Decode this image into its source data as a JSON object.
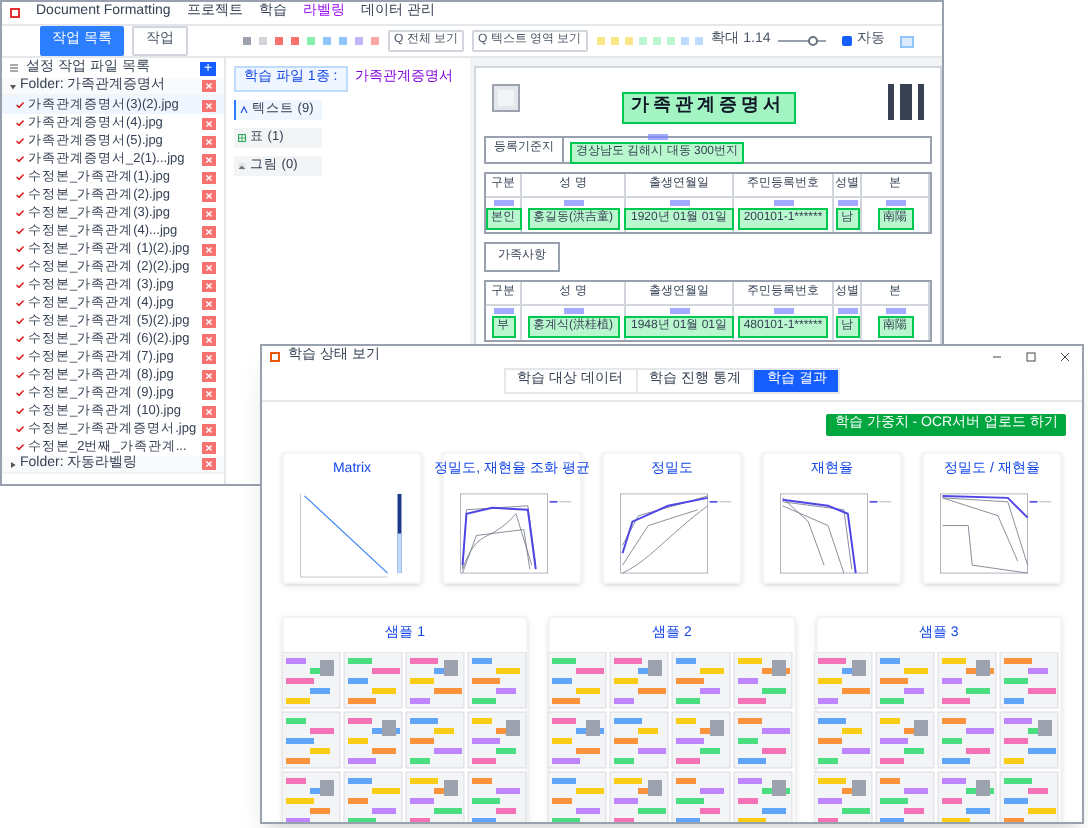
{
  "main_window": {
    "title": "Document Formatting",
    "menu": [
      "프로젝트",
      "학습",
      "라벨링",
      "데이터 관리"
    ],
    "toolbar": {
      "tabs": [
        {
          "label": "작업 목록",
          "selected": true
        },
        {
          "label": "작업",
          "selected": false
        }
      ],
      "buttons": [
        "Q 전체 보기",
        "Q 텍스트 영역 보기"
      ],
      "zoom_label": "확대 1.14",
      "zoom": {
        "level": 0.7
      },
      "auto": {
        "label": "자동",
        "checked": true
      }
    },
    "file_list": {
      "header": "설정 작업 파일 목록",
      "add_button": "+",
      "folders": [
        {
          "label": "Folder: 가족관계증명서",
          "expanded": true,
          "files": [
            {
              "name": "가족관계증명서(3)(2).jpg",
              "checked": true,
              "selected": true
            },
            {
              "name": "가족관계증명서(4).jpg",
              "checked": true,
              "selected": false
            },
            {
              "name": "가족관계증명서(5).jpg",
              "checked": true,
              "selected": false
            },
            {
              "name": "가족관계증명서_2(1)...jpg",
              "checked": true,
              "selected": false
            },
            {
              "name": "수정본_가족관계(1).jpg",
              "checked": true,
              "selected": false
            },
            {
              "name": "수정본_가족관계(2).jpg",
              "checked": true,
              "selected": false
            },
            {
              "name": "수정본_가족관계(3).jpg",
              "checked": true,
              "selected": false
            },
            {
              "name": "수정본_가족관계(4)...jpg",
              "checked": true,
              "selected": false
            },
            {
              "name": "수정본_가족관계 (1)(2).jpg",
              "checked": true,
              "selected": false
            },
            {
              "name": "수정본_가족관계 (2)(2).jpg",
              "checked": true,
              "selected": false
            },
            {
              "name": "수정본_가족관계 (3).jpg",
              "checked": true,
              "selected": false
            },
            {
              "name": "수정본_가족관계 (4).jpg",
              "checked": true,
              "selected": false
            },
            {
              "name": "수정본_가족관계 (5)(2).jpg",
              "checked": true,
              "selected": false
            },
            {
              "name": "수정본_가족관계 (6)(2).jpg",
              "checked": true,
              "selected": false
            },
            {
              "name": "수정본_가족관계 (7).jpg",
              "checked": true,
              "selected": false
            },
            {
              "name": "수정본_가족관계 (8).jpg",
              "checked": true,
              "selected": false
            },
            {
              "name": "수정본_가족관계 (9).jpg",
              "checked": true,
              "selected": false
            },
            {
              "name": "수정본_가족관계 (10).jpg",
              "checked": true,
              "selected": false
            },
            {
              "name": "수정본_가족관계증명서.jpg",
              "checked": true,
              "selected": false
            },
            {
              "name": "수정본_2번째_가족관계...",
              "checked": true,
              "selected": false
            }
          ]
        },
        {
          "label": "Folder: 자동라벨링",
          "expanded": false
        }
      ]
    },
    "panel": {
      "title": "학습 파일 1종 :",
      "doc_name": "가족관계증명서",
      "items": [
        {
          "kind": "text",
          "label": "텍스트 (9)",
          "selected": true
        },
        {
          "kind": "table",
          "label": "표 (1)",
          "selected": false
        },
        {
          "kind": "image",
          "label": "그림 (0)",
          "selected": false
        }
      ]
    },
    "document": {
      "title": "가족관계증명서",
      "origin_label": "등록기준지",
      "origin_value": "경상남도 김해시 대동 300번지",
      "columns": [
        "구분",
        "성 명",
        "출생연월일",
        "주민등록번호",
        "성별",
        "본"
      ],
      "self_row": [
        "본인",
        "홍길동(洪吉童)",
        "1920년 01월 01일",
        "200101-1******",
        "남",
        "南陽"
      ],
      "family_label": "가족사항",
      "family_columns": [
        "구분",
        "성 명",
        "출생연월일",
        "주민등록번호",
        "성별",
        "본"
      ],
      "family_rows": [
        [
          "부",
          "홍계식(洪桂植)",
          "1948년 01월 01일",
          "480101-1******",
          "남",
          "南陽"
        ]
      ]
    }
  },
  "dialog": {
    "title": "학습 상태 보기",
    "tabs": [
      {
        "label": "학습 대상 데이터",
        "selected": false
      },
      {
        "label": "학습 진행 통계",
        "selected": false
      },
      {
        "label": "학습 결과",
        "selected": true
      }
    ],
    "upload_button": "학습 가중치 - OCR서버 업로드 하기",
    "charts": [
      {
        "title": "Matrix",
        "kind": "matrix"
      },
      {
        "title": "정밀도, 재현율 조화 평균",
        "kind": "f1"
      },
      {
        "title": "정밀도",
        "kind": "precision"
      },
      {
        "title": "재현율",
        "kind": "recall"
      },
      {
        "title": "정밀도 / 재현율",
        "kind": "pr"
      }
    ],
    "samples": [
      {
        "title": "샘플 1"
      },
      {
        "title": "샘플 2"
      },
      {
        "title": "샘플 3"
      }
    ]
  }
}
